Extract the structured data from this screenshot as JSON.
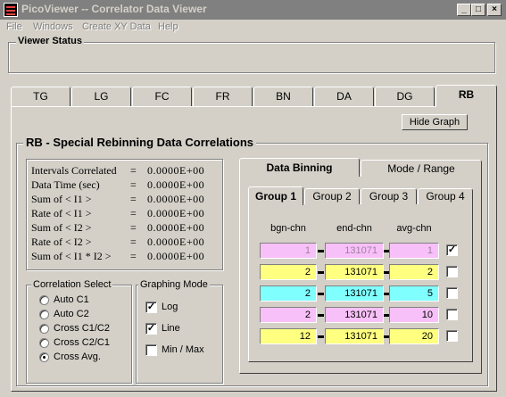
{
  "window": {
    "title": "PicoViewer -- Correlator Data Viewer",
    "controls": {
      "minimize": "_",
      "maximize": "□",
      "close": "×"
    }
  },
  "menu": [
    "File",
    "Windows",
    "Create XY Data",
    "Help"
  ],
  "viewer_status": {
    "label": "Viewer  Status",
    "text": ""
  },
  "tabs": [
    "TG",
    "LG",
    "FC",
    "FR",
    "BN",
    "DA",
    "DG",
    "RB"
  ],
  "active_tab": "RB",
  "hide_graph_button": "Hide Graph",
  "section_title": "RB - Special Rebinning Data Correlations",
  "correlations": [
    {
      "label": "Intervals Correlated",
      "eq": "=",
      "value": "0.0000E+00"
    },
    {
      "label": "Data Time (sec)",
      "eq": "=",
      "value": "0.0000E+00"
    },
    {
      "label": "Sum  of < I1 >",
      "eq": "=",
      "value": "0.0000E+00"
    },
    {
      "label": "Rate  of < I1 >",
      "eq": "=",
      "value": "0.0000E+00"
    },
    {
      "label": "Sum  of < I2 >",
      "eq": "=",
      "value": "0.0000E+00"
    },
    {
      "label": "Rate  of < I2 >",
      "eq": "=",
      "value": "0.0000E+00"
    },
    {
      "label": "Sum  of < I1 * I2 >",
      "eq": "=",
      "value": "0.0000E+00"
    }
  ],
  "correlation_select": {
    "label": "Correlation Select",
    "options": [
      "Auto  C1",
      "Auto  C2",
      "Cross C1/C2",
      "Cross C2/C1",
      "Cross Avg."
    ],
    "selected": "Cross Avg."
  },
  "graphing_mode": {
    "label": "Graphing  Mode",
    "options": [
      {
        "label": "Log",
        "checked": true
      },
      {
        "label": "Line",
        "checked": true
      },
      {
        "label": "Min / Max",
        "checked": false
      }
    ]
  },
  "binning_tabs": [
    "Data Binning",
    "Mode / Range"
  ],
  "active_binning_tab": "Data Binning",
  "group_tabs": [
    "Group 1",
    "Group 2",
    "Group 3",
    "Group 4"
  ],
  "active_group_tab": "Group 1",
  "column_headers": [
    "bgn-chn",
    "end-chn",
    "avg-chn"
  ],
  "rows": [
    {
      "bgn": "1",
      "end": "131071",
      "avg": "1",
      "color": "#f8c0f8",
      "text_color": "#a080a0",
      "checked": true
    },
    {
      "bgn": "2",
      "end": "131071",
      "avg": "2",
      "color": "#ffff80",
      "text_color": "#000000",
      "checked": false
    },
    {
      "bgn": "2",
      "end": "131071",
      "avg": "5",
      "color": "#80ffff",
      "text_color": "#000000",
      "checked": false
    },
    {
      "bgn": "2",
      "end": "131071",
      "avg": "10",
      "color": "#f8c0f8",
      "text_color": "#000000",
      "checked": false
    },
    {
      "bgn": "12",
      "end": "131071",
      "avg": "20",
      "color": "#ffff80",
      "text_color": "#000000",
      "checked": false
    }
  ]
}
